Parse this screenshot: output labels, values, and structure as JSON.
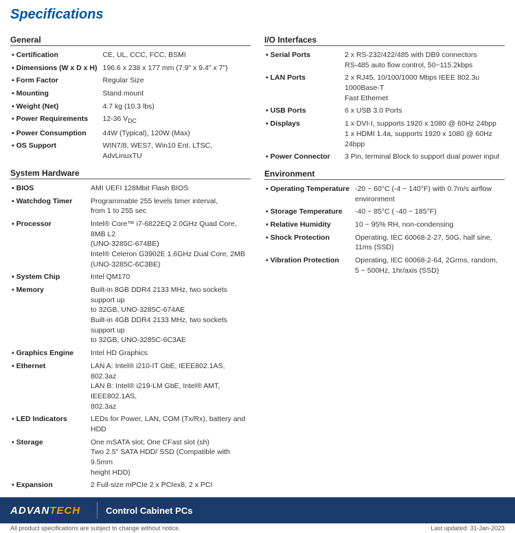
{
  "title": "Specifications",
  "left": {
    "general": {
      "section": "General",
      "rows": [
        {
          "label": "Certification",
          "value": "CE, UL, CCC, FCC, BSMI"
        },
        {
          "label": "Dimensions (W x D x H)",
          "value": "196.6 x 238 x 177 mm (7.9\" x 9.4\" x 7\")"
        },
        {
          "label": "Form Factor",
          "value": "Regular Size"
        },
        {
          "label": "Mounting",
          "value": "Stand mount"
        },
        {
          "label": "Weight (Net)",
          "value": "4.7 kg (10.3 lbs)"
        },
        {
          "label": "Power Requirements",
          "value": "12-36 VDC"
        },
        {
          "label": "Power Consumption",
          "value": "44W (Typical), 120W (Max)"
        },
        {
          "label": "OS Support",
          "value": "WIN7/8, WES7, Win10 Ent. LTSC, AdvLinuxTU"
        }
      ]
    },
    "system": {
      "section": "System Hardware",
      "rows": [
        {
          "label": "BIOS",
          "value": "AMI UEFI 128Mbit Flash BIOS"
        },
        {
          "label": "Watchdog Timer",
          "value": "Programmable 255 levels timer interval,\nfrom 1 to 255 sec"
        },
        {
          "label": "Processor",
          "value": "Intel® Core™ i7-6822EQ 2.0GHz Quad Core, 8MB L2\n(UNO-3285C-674BE)\nIntel® Celeron G3902E 1.6GHz Dual Core, 2MB\n(UNO-3285C-6C3BE)"
        },
        {
          "label": "System Chip",
          "value": "Intel QM170"
        },
        {
          "label": "Memory",
          "value": "Built-in 8GB DDR4 2133 MHz, two sockets support up\nto 32GB, UNO-3285C-674AE\nBuilt-in 4GB DDR4 2133 MHz, two sockets support up\nto 32GB, UNO-3285C-6C3AE"
        },
        {
          "label": "Graphics Engine",
          "value": "Intel HD Graphics"
        },
        {
          "label": "Ethernet",
          "value": "LAN A: Intel® i210-IT GbE, IEEE802.1AS, 802.3az\nLAN B: Intel® i219-LM GbE, Intel® AMT, IEEE802.1AS,\n802.3az"
        },
        {
          "label": "LED Indicators",
          "value": "LEDs for Power, LAN, COM (Tx/Rx), battery and HDD"
        },
        {
          "label": "Storage",
          "value": "One mSATA slot; One CFast slot (sh)\nTwo 2.5\" SATA HDD/ SSD (Compatible with 9.5mm\nheight HDD)"
        },
        {
          "label": "Expansion",
          "value": "2 Full-size mPCIe 2 x PCIex8, 2 x PCI"
        }
      ]
    }
  },
  "right": {
    "io": {
      "section": "I/O Interfaces",
      "rows": [
        {
          "label": "Serial Ports",
          "value": "2 x RS-232/422/485 with DB9 connectors\nRS-485 auto flow control, 50~115.2kbps"
        },
        {
          "label": "LAN Ports",
          "value": "2 x RJ45, 10/100/1000 Mbps IEEE 802.3u 1000Base-T\nFast Ethernet"
        },
        {
          "label": "USB Ports",
          "value": "6 x USB 3.0 Ports"
        },
        {
          "label": "Displays",
          "value": "1 x DVI-I, supports 1920 x 1080 @ 60Hz 24bpp\n1 x HDMI 1.4a, supports 1920 x 1080 @ 60Hz 24bpp"
        },
        {
          "label": "Power Connector",
          "value": "3 Pin, terminal Block to support dual power input"
        }
      ]
    },
    "env": {
      "section": "Environment",
      "rows": [
        {
          "label": "Operating Temperature",
          "value": "-20 ~ 60°C (-4 ~ 140°F) with 0.7m/s airflow\nenvironment"
        },
        {
          "label": "Storage Temperature",
          "value": "-40 ~ 85°C ( -40 ~ 185°F)"
        },
        {
          "label": "Relative Humidity",
          "value": "10 ~ 95% RH, non-condensing"
        },
        {
          "label": "Shock Protection",
          "value": "Operating, IEC 60068-2-27, 50G, half sine,\n11ms (SSD)"
        },
        {
          "label": "Vibration Protection",
          "value": "Operating, IEC 60068-2-64, 2Grms, random,\n5 ~ 500Hz, 1hr/axis (SSD)"
        }
      ]
    }
  },
  "footer": {
    "logo_advan": "AD",
    "logo_van": "VAN",
    "logo_tech": "TECH",
    "logo_full": "ADVANTECH",
    "product": "Control Cabinet PCs",
    "note_left": "All product specifications are subject to change without notice.",
    "note_right": "Last updated: 31-Jan-2023"
  }
}
